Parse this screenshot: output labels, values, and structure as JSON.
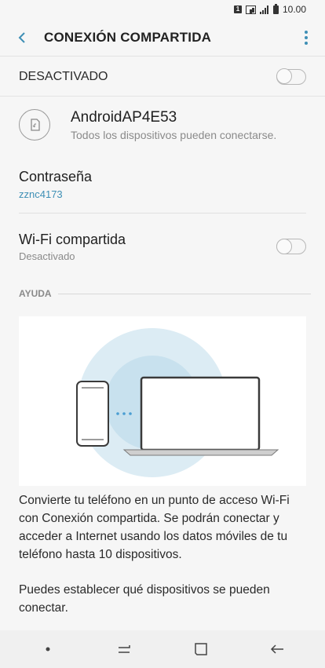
{
  "status_bar": {
    "sim_label": "1",
    "time": "10.00"
  },
  "app_bar": {
    "title": "CONEXIÓN COMPARTIDA",
    "back_icon": "chevron-left-icon",
    "more_icon": "more-vertical-icon"
  },
  "master_switch": {
    "label": "DESACTIVADO",
    "on": false
  },
  "network": {
    "name": "AndroidAP4E53",
    "description": "Todos los dispositivos pueden conectarse."
  },
  "password": {
    "title": "Contraseña",
    "value": "zznc4173"
  },
  "wifi_shared": {
    "title": "Wi-Fi compartida",
    "status": "Desactivado",
    "on": false
  },
  "help": {
    "label": "AYUDA",
    "paragraph1": "Convierte tu teléfono en un punto de acceso Wi-Fi con Conexión compartida. Se podrán conectar y acceder a Internet usando los datos móviles de tu teléfono hasta 10 dispositivos.",
    "paragraph2": "Puedes establecer qué dispositivos se pueden conectar."
  },
  "colors": {
    "accent": "#3e8fb5",
    "circle_outer": "#dcecf4",
    "circle_inner": "#c8e1ee"
  }
}
